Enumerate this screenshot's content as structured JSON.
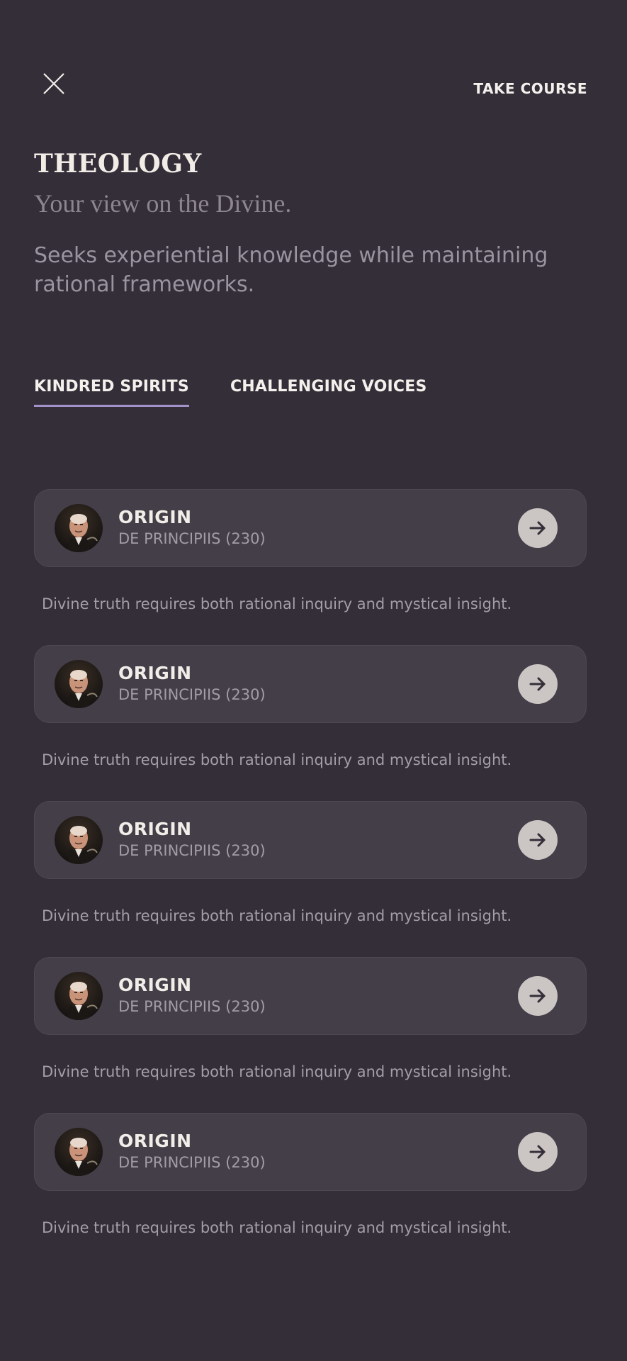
{
  "header": {
    "close_icon": "close-icon",
    "take_course_label": "TAKE COURSE"
  },
  "hero": {
    "title": "THEOLOGY",
    "subtitle": "Your view on the Divine.",
    "description": "Seeks experiential knowledge while maintaining rational frameworks."
  },
  "tabs": [
    {
      "label": "KINDRED SPIRITS",
      "active": true
    },
    {
      "label": "CHALLENGING VOICES",
      "active": false
    }
  ],
  "accent_color": "#a391c9",
  "items": [
    {
      "name": "ORIGIN",
      "work": "DE PRINCIPIIS (230)",
      "quote": "Divine truth requires both rational inquiry and mystical insight.",
      "icon": "arrow-right-icon"
    },
    {
      "name": "ORIGIN",
      "work": "DE PRINCIPIIS (230)",
      "quote": "Divine truth requires both rational inquiry and mystical insight.",
      "icon": "arrow-right-icon"
    },
    {
      "name": "ORIGIN",
      "work": "DE PRINCIPIIS (230)",
      "quote": "Divine truth requires both rational inquiry and mystical insight.",
      "icon": "arrow-right-icon"
    },
    {
      "name": "ORIGIN",
      "work": "DE PRINCIPIIS (230)",
      "quote": "Divine truth requires both rational inquiry and mystical insight.",
      "icon": "arrow-right-icon"
    },
    {
      "name": "ORIGIN",
      "work": "DE PRINCIPIIS (230)",
      "quote": "Divine truth requires both rational inquiry and mystical insight.",
      "icon": "arrow-right-icon"
    }
  ]
}
